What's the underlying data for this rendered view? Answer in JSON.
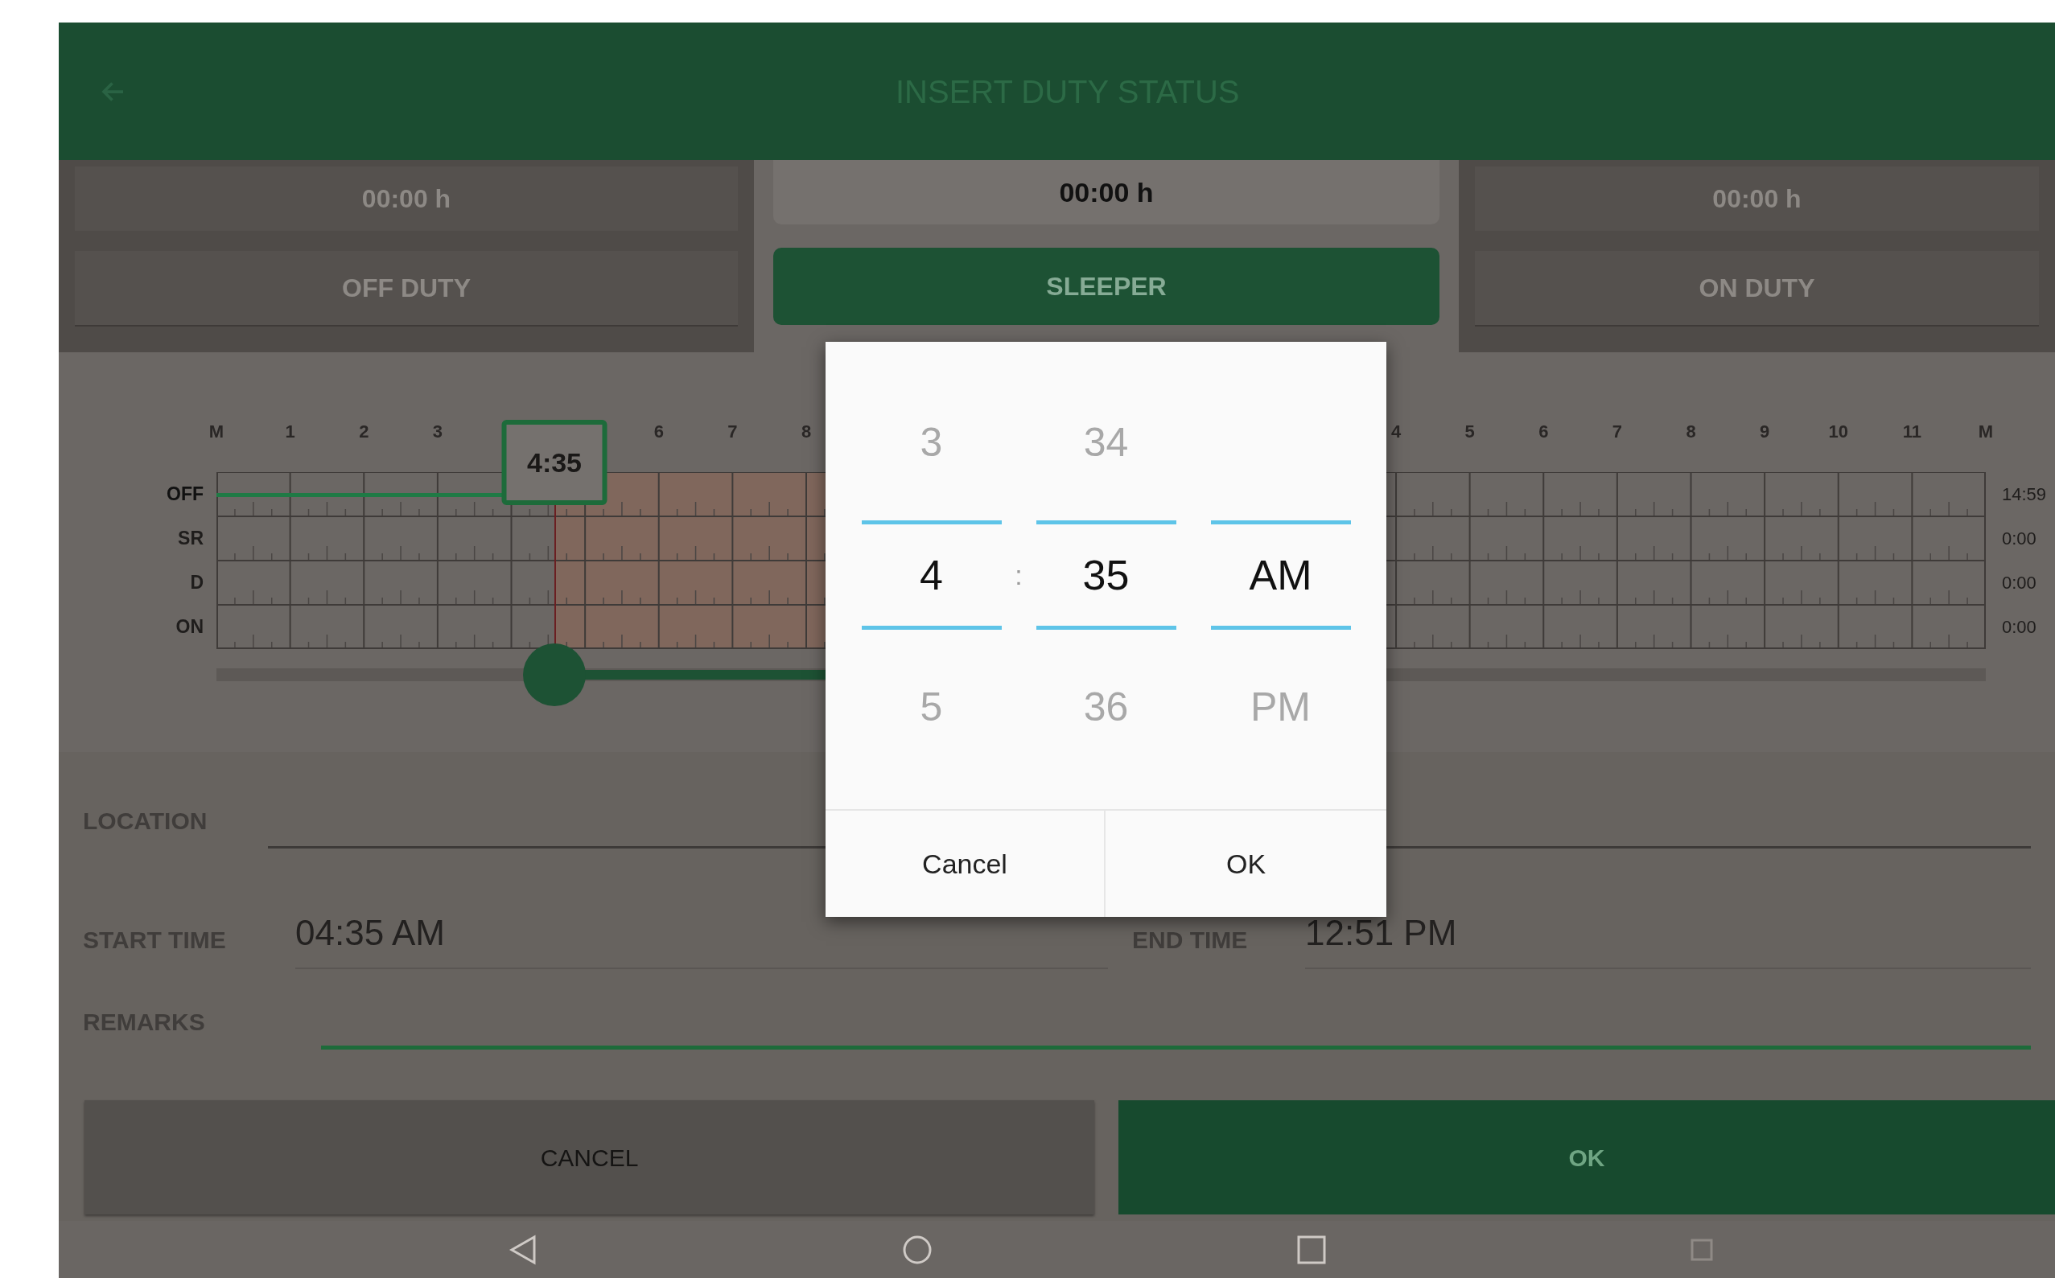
{
  "app_bar": {
    "title": "INSERT DUTY STATUS"
  },
  "duty_statuses": [
    {
      "label": "OFF DUTY",
      "time": "00:00 h",
      "selected": false
    },
    {
      "label": "SLEEPER",
      "time": "00:00 h",
      "selected": true
    },
    {
      "label": "ON DUTY",
      "time": "00:00 h",
      "selected": false
    }
  ],
  "log_graph": {
    "hour_label_groups": [
      [
        "M",
        "1",
        "2",
        "3"
      ],
      [
        "6",
        "7",
        "8"
      ],
      [
        "4",
        "5",
        "6",
        "7",
        "8",
        "9",
        "10",
        "11",
        "M"
      ]
    ],
    "rows": [
      {
        "label": "OFF",
        "total": "14:59",
        "active": true
      },
      {
        "label": "SR",
        "total": "0:00",
        "active": false
      },
      {
        "label": "D",
        "total": "0:00",
        "active": false
      },
      {
        "label": "ON",
        "total": "0:00",
        "active": false
      }
    ],
    "marker": "4:35",
    "range": {
      "start": {
        "level": 0.191
      },
      "span": {
        "level": 0.344
      }
    }
  },
  "form": {
    "location": {
      "label": "LOCATION"
    },
    "start_time": {
      "label": "START TIME",
      "value": "04:35 AM"
    },
    "end_time": {
      "label": "END TIME",
      "value": "12:51 PM"
    },
    "remarks": {
      "label": "REMARKS",
      "focused": true
    }
  },
  "buttons": [
    {
      "label": "CANCEL",
      "kind": "secondary"
    },
    {
      "label": "OK",
      "kind": "primary"
    }
  ],
  "time_picker": {
    "columns": [
      {
        "above": "3",
        "value": "4",
        "below": "5"
      },
      {
        "above": "34",
        "value": "35",
        "below": "36"
      },
      {
        "value": "AM",
        "below": "PM"
      }
    ],
    "separator": ":",
    "buttons": [
      "Cancel",
      "OK"
    ]
  }
}
